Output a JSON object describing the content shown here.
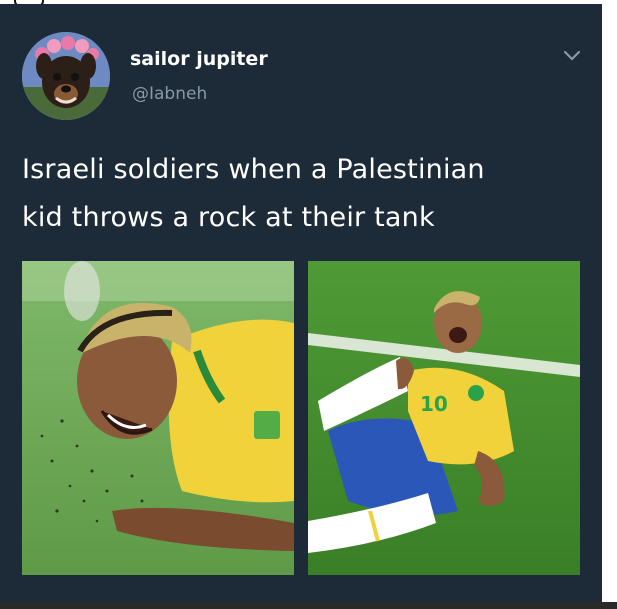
{
  "tweet": {
    "display_name": "sailor jupiter",
    "handle": "@Iabneh",
    "text": "Israeli soldiers when a Palestinian\nkid throws a rock at their tank",
    "menu_icon": "chevron-down-icon",
    "avatar_icon": "dog-avatar"
  },
  "photos": {
    "left_jersey_number": "",
    "right_jersey_number": "10"
  },
  "colors": {
    "card_bg": "#1d2a38",
    "secondary_text": "#8899a6",
    "jersey_yellow": "#f2d23a",
    "shorts_blue": "#2b57b8",
    "grass_green": "#3f8a2e"
  }
}
